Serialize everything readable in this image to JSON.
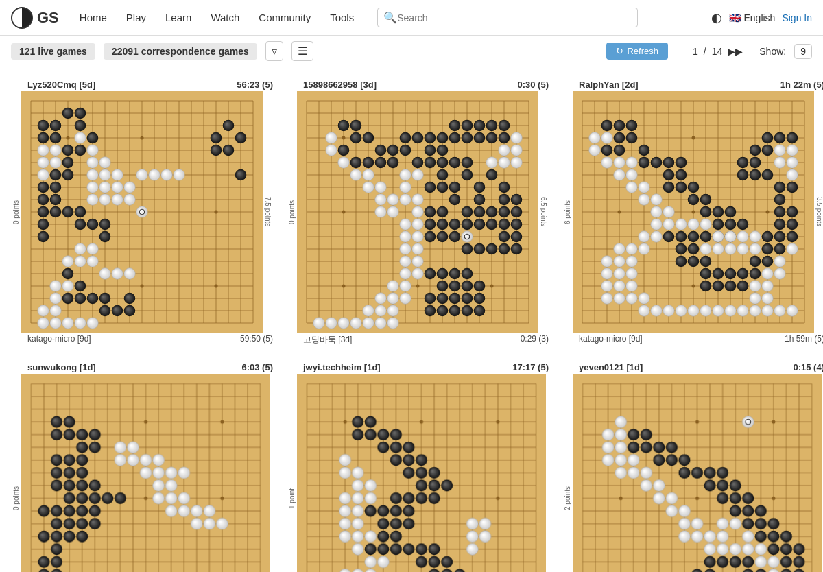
{
  "nav": {
    "logo_text": "GS",
    "links": [
      "Home",
      "Play",
      "Learn",
      "Watch",
      "Community",
      "Tools"
    ],
    "search_placeholder": "Search",
    "lang": "English",
    "sign_in": "Sign In"
  },
  "toolbar": {
    "live_games": "121 live games",
    "corr_games": "22091 correspondence games",
    "refresh_label": "Refresh",
    "page_current": "1",
    "page_sep": "/",
    "page_total": "14",
    "show_label": "Show:",
    "show_num": "9"
  },
  "games": [
    {
      "player_top": "Lyz520Cmq [5d]",
      "time_top": "56:23  (5)",
      "player_bottom": "katago-micro [9d]",
      "time_bottom": "59:50  (5)",
      "left_label": "0 points",
      "right_label": "7.5 points",
      "id": "game1"
    },
    {
      "player_top": "15898662958 [3d]",
      "time_top": "0:30  (5)",
      "player_bottom": "고딩바둑 [3d]",
      "time_bottom": "0:29  (3)",
      "left_label": "0 points",
      "right_label": "6.5 points",
      "id": "game2"
    },
    {
      "player_top": "RalphYan [2d]",
      "time_top": "1h 22m  (5)",
      "player_bottom": "katago-micro [9d]",
      "time_bottom": "1h 59m  (5)",
      "left_label": "6 points",
      "right_label": "3.5 points",
      "id": "game3"
    },
    {
      "player_top": "sunwukong [1d]",
      "time_top": "6:03  (5)",
      "player_bottom": "",
      "time_bottom": "",
      "left_label": "0 points",
      "right_label": "",
      "id": "game4"
    },
    {
      "player_top": "jwyi.techheim [1d]",
      "time_top": "17:17  (5)",
      "player_bottom": "",
      "time_bottom": "",
      "left_label": "1 point",
      "right_label": "",
      "id": "game5"
    },
    {
      "player_top": "yeven0121 [1d]",
      "time_top": "0:15  (4)",
      "player_bottom": "",
      "time_bottom": "",
      "left_label": "2 points",
      "right_label": "",
      "id": "game6"
    }
  ]
}
